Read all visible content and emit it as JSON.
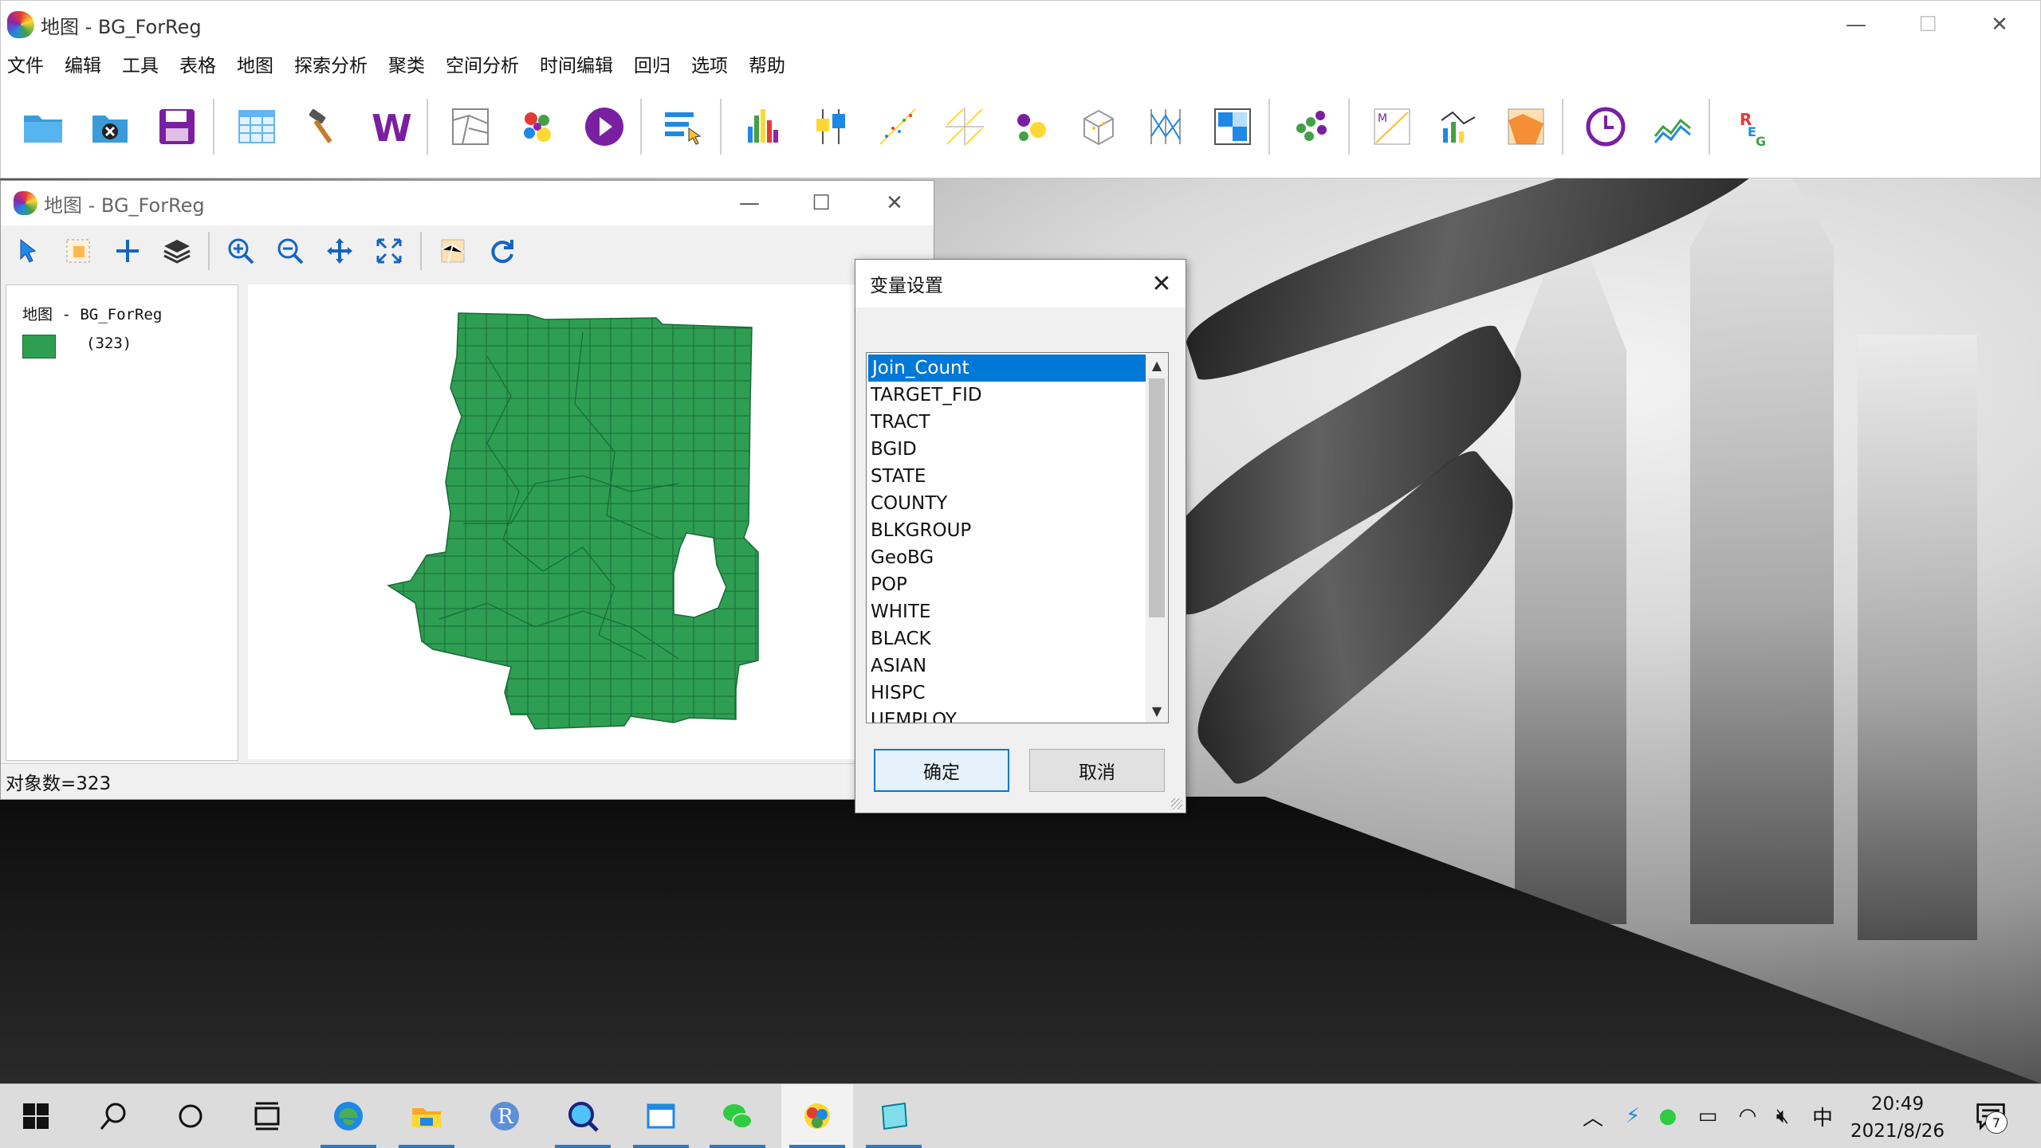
{
  "app": {
    "title": "地图 - BG_ForReg",
    "menu": [
      "文件",
      "编辑",
      "工具",
      "表格",
      "地图",
      "探索分析",
      "聚类",
      "空间分析",
      "时间编辑",
      "回归",
      "选项",
      "帮助"
    ],
    "window_controls": {
      "minimize": "—",
      "maximize": "☐",
      "close": "✕"
    }
  },
  "map_window": {
    "title": "地图 - BG_ForReg",
    "legend_title": "地图 - BG_ForReg",
    "legend_count": "(323)",
    "legend_color": "#2e9e52",
    "status": "对象数=323"
  },
  "dialog": {
    "title": "变量设置",
    "close": "✕",
    "variables": [
      "Join_Count",
      "TARGET_FID",
      "TRACT",
      "BGID",
      "STATE",
      "COUNTY",
      "BLKGROUP",
      "GeoBG",
      "POP",
      "WHITE",
      "BLACK",
      "ASIAN",
      "HISPC",
      "UEMPLOY"
    ],
    "selected": "Join_Count",
    "ok": "确定",
    "cancel": "取消"
  },
  "taskbar": {
    "time": "20:49",
    "date": "2021/8/26",
    "ime": "中",
    "notifications": "7"
  },
  "colors": {
    "selection": "#0078d7",
    "map_fill": "#2e9e52",
    "taskbar_accent": "#2b79c2"
  }
}
